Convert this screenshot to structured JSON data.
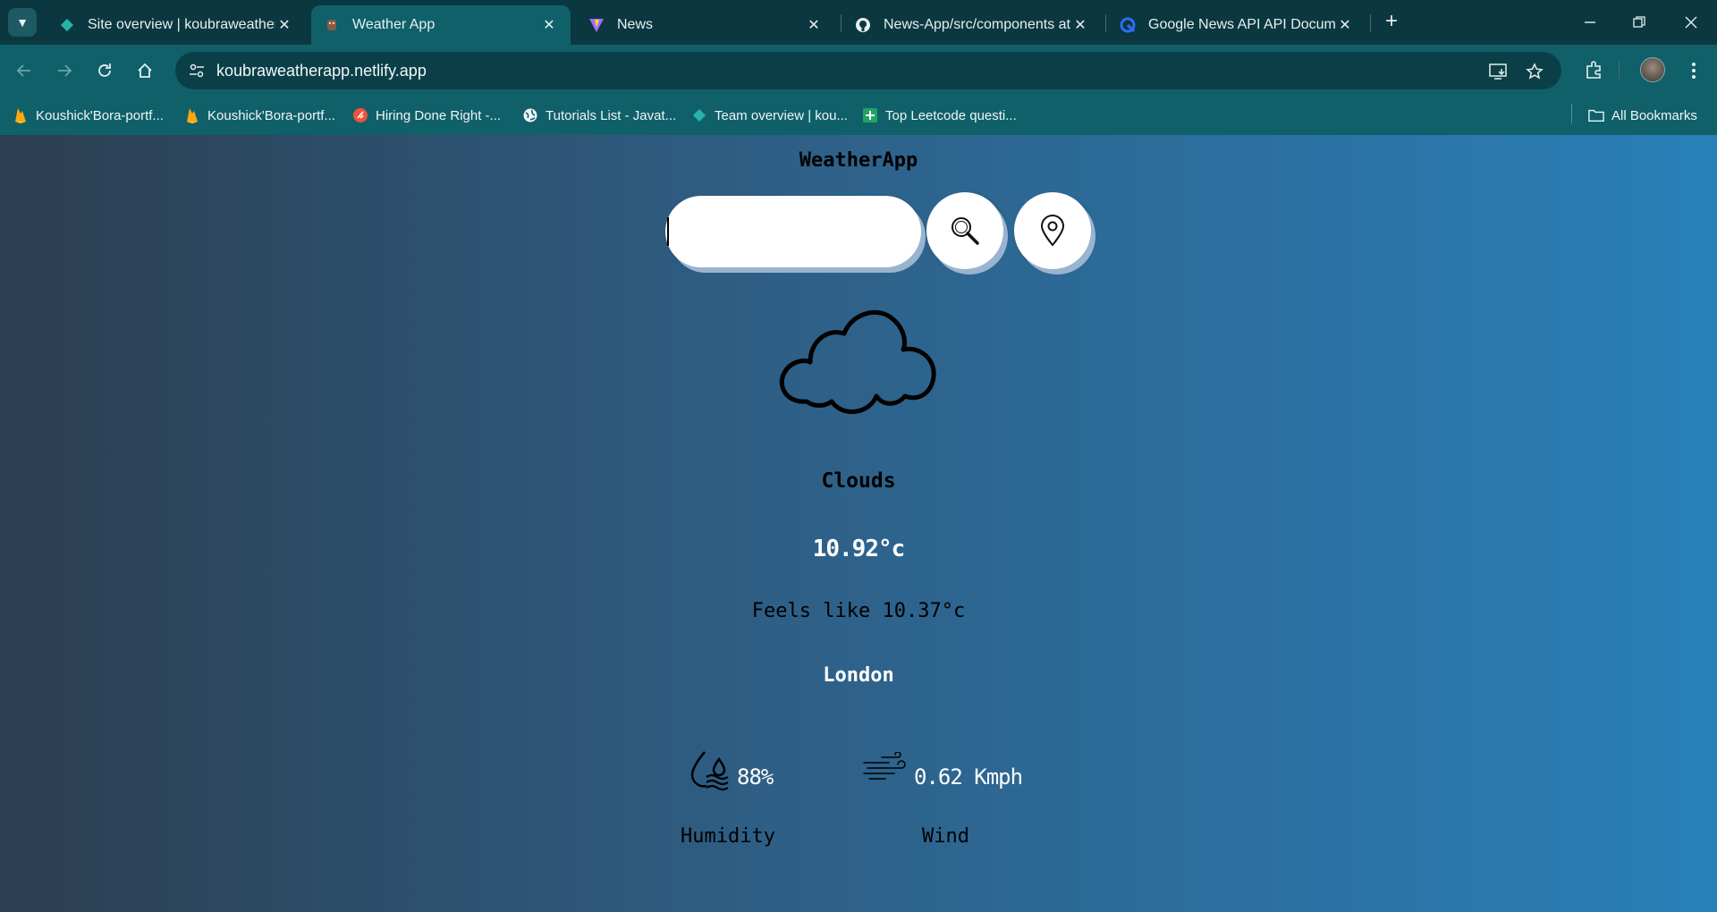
{
  "browser": {
    "tabs": [
      {
        "title": "Site overview | koubraweathera",
        "favicon": "netlify-diamond-icon",
        "active": false
      },
      {
        "title": "Weather App",
        "favicon": "weather-app-favicon",
        "active": true
      },
      {
        "title": "News",
        "favicon": "vite-icon",
        "active": false
      },
      {
        "title": "News-App/src/components at m",
        "favicon": "github-icon",
        "active": false
      },
      {
        "title": "Google News API API Documen",
        "favicon": "api-docs-icon",
        "active": false
      }
    ],
    "address": {
      "url": "koubraweatherapp.netlify.app"
    },
    "bookmarks": [
      {
        "label": "Koushick'Bora-portf...",
        "icon": "firebase-icon"
      },
      {
        "label": "Koushick'Bora-portf...",
        "icon": "firebase-icon"
      },
      {
        "label": "Hiring Done Right -...",
        "icon": "rocket-icon"
      },
      {
        "label": "Tutorials List - Javat...",
        "icon": "globe-icon"
      },
      {
        "label": "Team overview | kou...",
        "icon": "netlify-diamond-icon"
      },
      {
        "label": "Top Leetcode questi...",
        "icon": "sheets-icon"
      }
    ],
    "all_bookmarks": "All Bookmarks"
  },
  "app": {
    "title": "WeatherApp",
    "search": {
      "value": "",
      "placeholder": ""
    },
    "condition": "Clouds",
    "condition_icon": "cloud-icon",
    "temperature": "10.92°c",
    "feels_like": "Feels like 10.37°c",
    "city": "London",
    "humidity": {
      "value": "88%",
      "label": "Humidity",
      "icon": "humidity-icon"
    },
    "wind": {
      "value": "0.62 Kmph",
      "label": "Wind",
      "icon": "wind-icon"
    }
  },
  "colors": {
    "gradient_start": "#2c3e50",
    "gradient_end": "#2980b9",
    "browser_frame": "#0b3840",
    "toolbar": "#10606a"
  }
}
